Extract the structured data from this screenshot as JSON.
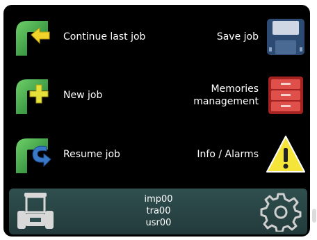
{
  "menu_left": [
    {
      "label": "Continue last job",
      "icon": "continue-job-icon"
    },
    {
      "label": "New job",
      "icon": "new-job-icon"
    },
    {
      "label": "Resume job",
      "icon": "resume-job-icon"
    }
  ],
  "menu_right": [
    {
      "lines": [
        "Save job"
      ],
      "icon": "floppy-disk-icon"
    },
    {
      "lines": [
        "Memories",
        "management"
      ],
      "icon": "memory-drawers-icon"
    },
    {
      "lines": [
        "Info / Alarms"
      ],
      "icon": "warning-icon"
    }
  ],
  "status_bar": {
    "implement": "imp00",
    "tractor": "tra00",
    "user": "usr00",
    "left_icon": "tractor-icon",
    "right_icon": "gear-icon"
  },
  "colors": {
    "pipe_green": "#2f9a3f",
    "accent_yellow": "#f2d32a",
    "accent_blue": "#3a78c8",
    "bar_teal": "#2f4f4e",
    "alarm_red": "#d43a34"
  }
}
